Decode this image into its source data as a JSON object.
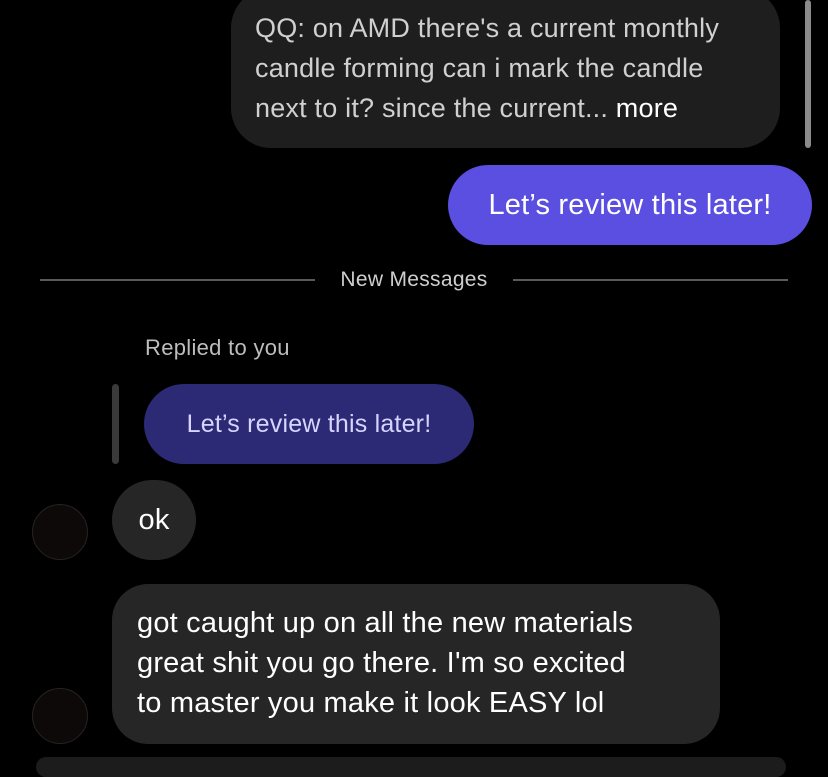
{
  "thread": {
    "quoted_message": {
      "line1": "QQ: on AMD there's a current monthly",
      "line2": "candle forming can i mark the candle",
      "line3": "next to it? since the current...",
      "more_label": "more"
    },
    "sent_message": "Let’s review this later!",
    "divider_label": "New Messages",
    "reply_caption": "Replied to you",
    "reply_quote": "Let’s review this later!",
    "received_short": "ok",
    "received_long": {
      "line1": "got caught up on all the new materials",
      "line2": "great shit you go there. I'm so excited",
      "line3": "to master you make it look EASY lol"
    }
  },
  "colors": {
    "background": "#000000",
    "sent_bubble": "#5b4fe1",
    "reply_quote_bubble": "#2c2a75",
    "received_bubble": "#262626",
    "quoted_bubble": "#1e1e1e"
  }
}
